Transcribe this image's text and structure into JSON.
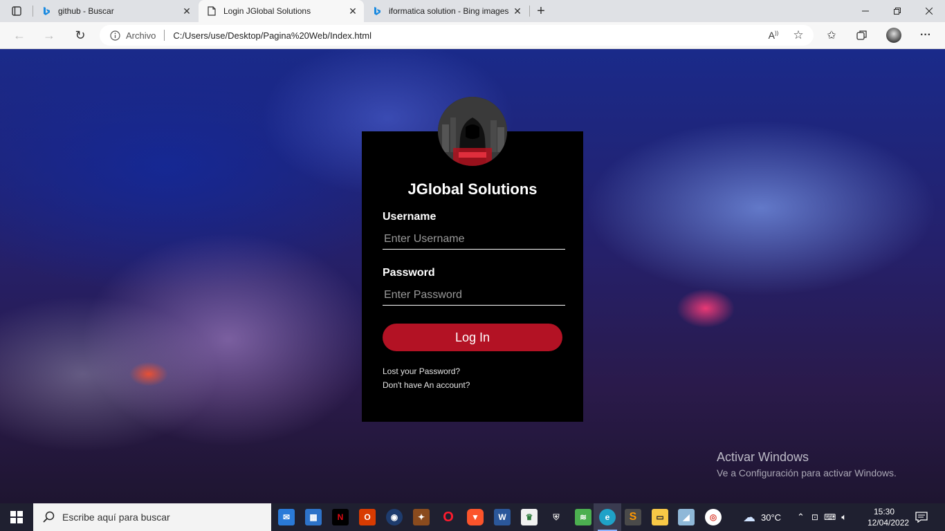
{
  "browser": {
    "tabs": [
      {
        "title": "github - Buscar",
        "active": false,
        "icon": "bing-icon"
      },
      {
        "title": "Login JGlobal Solutions",
        "active": true,
        "icon": "page-icon"
      },
      {
        "title": "iformatica solution - Bing images",
        "active": false,
        "icon": "bing-icon"
      }
    ],
    "address": {
      "scheme_label": "Archivo",
      "url": "C:/Users/use/Desktop/Pagina%20Web/Index.html"
    }
  },
  "login": {
    "title": "JGlobal Solutions",
    "username_label": "Username",
    "username_placeholder": "Enter Username",
    "password_label": "Password",
    "password_placeholder": "Enter Password",
    "login_button": "Log In",
    "lost_password": "Lost your Password?",
    "no_account": "Don't have An account?"
  },
  "watermark": {
    "title": "Activar Windows",
    "subtitle": "Ve a Configuración para activar Windows."
  },
  "taskbar": {
    "search_placeholder": "Escribe aquí para buscar",
    "weather": "30°C",
    "time": "15:30",
    "date": "12/04/2022",
    "apps": [
      "mail-icon",
      "store-icon",
      "netflix-icon",
      "office-icon",
      "app-icon",
      "game-icon",
      "opera-icon",
      "brave-icon",
      "word-icon",
      "app-icon",
      "tank-game-icon",
      "layers-icon",
      "edge-icon",
      "sublime-icon",
      "file-explorer-icon",
      "app-icon",
      "chrome-icon"
    ]
  }
}
